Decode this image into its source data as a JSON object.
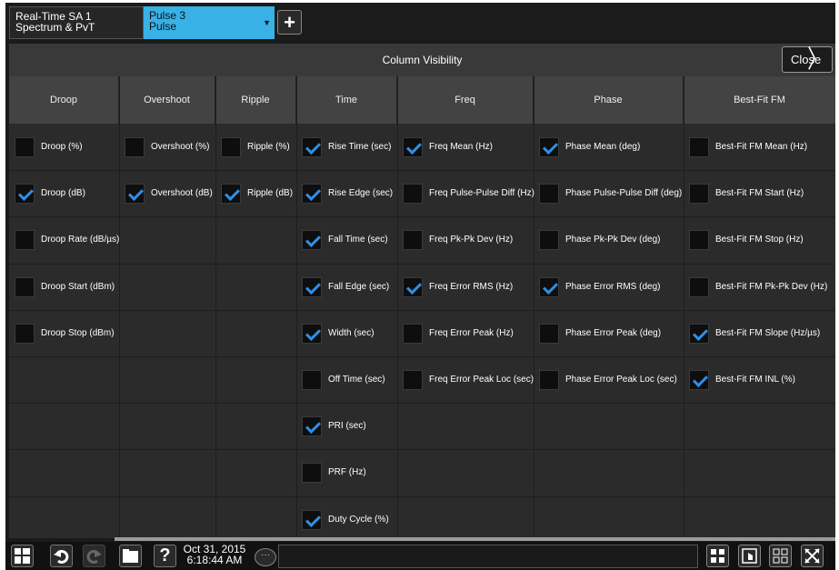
{
  "tabs": {
    "screen_tab": {
      "line1": "Real-Time SA 1",
      "line2": "Spectrum & PvT"
    },
    "measure_tab": {
      "line1": "Pulse 3",
      "line2": "Pulse",
      "arrow": "▼"
    },
    "add_label": "+"
  },
  "dialog": {
    "title": "Column Visibility",
    "close_label": "Close",
    "close_chevron": "〉"
  },
  "columns": [
    "Droop",
    "Overshoot",
    "Ripple",
    "Time",
    "Freq",
    "Phase",
    "Best-Fit FM"
  ],
  "cells": {
    "droop": [
      {
        "label": "Droop (%)",
        "checked": false
      },
      {
        "label": "Droop (dB)",
        "checked": true
      },
      {
        "label": "Droop Rate (dB/µs)",
        "checked": false
      },
      {
        "label": "Droop Start (dBm)",
        "checked": false
      },
      {
        "label": "Droop Stop (dBm)",
        "checked": false
      }
    ],
    "overshoot": [
      {
        "label": "Overshoot (%)",
        "checked": false
      },
      {
        "label": "Overshoot (dB)",
        "checked": true
      }
    ],
    "ripple": [
      {
        "label": "Ripple (%)",
        "checked": false
      },
      {
        "label": "Ripple (dB)",
        "checked": true
      }
    ],
    "time": [
      {
        "label": "Rise Time (sec)",
        "checked": true
      },
      {
        "label": "Rise Edge (sec)",
        "checked": true
      },
      {
        "label": "Fall Time (sec)",
        "checked": true
      },
      {
        "label": "Fall Edge (sec)",
        "checked": true
      },
      {
        "label": "Width (sec)",
        "checked": true
      },
      {
        "label": "Off Time (sec)",
        "checked": false
      },
      {
        "label": "PRI (sec)",
        "checked": true
      },
      {
        "label": "PRF (Hz)",
        "checked": false
      },
      {
        "label": "Duty Cycle (%)",
        "checked": true
      }
    ],
    "freq": [
      {
        "label": "Freq Mean (Hz)",
        "checked": true
      },
      {
        "label": "Freq Pulse-Pulse Diff (Hz)",
        "checked": false
      },
      {
        "label": "Freq Pk-Pk Dev (Hz)",
        "checked": false
      },
      {
        "label": "Freq Error RMS (Hz)",
        "checked": true
      },
      {
        "label": "Freq Error Peak (Hz)",
        "checked": false
      },
      {
        "label": "Freq Error Peak Loc (sec)",
        "checked": false
      }
    ],
    "phase": [
      {
        "label": "Phase Mean (deg)",
        "checked": true
      },
      {
        "label": "Phase Pulse-Pulse Diff (deg)",
        "checked": false
      },
      {
        "label": "Phase Pk-Pk Dev (deg)",
        "checked": false
      },
      {
        "label": "Phase Error RMS (deg)",
        "checked": true
      },
      {
        "label": "Phase Error Peak (deg)",
        "checked": false
      },
      {
        "label": "Phase Error Peak Loc (sec)",
        "checked": false
      }
    ],
    "bestfit": [
      {
        "label": "Best-Fit FM Mean (Hz)",
        "checked": false
      },
      {
        "label": "Best-Fit FM Start (Hz)",
        "checked": false
      },
      {
        "label": "Best-Fit FM Stop (Hz)",
        "checked": false
      },
      {
        "label": "Best-Fit FM Pk-Pk Dev (Hz)",
        "checked": false
      },
      {
        "label": "Best-Fit FM Slope (Hz/µs)",
        "checked": true
      },
      {
        "label": "Best-Fit FM INL (%)",
        "checked": true
      }
    ]
  },
  "taskbar": {
    "date": "Oct 31, 2015",
    "time": "6:18:44 AM",
    "icons": [
      "windows-icon",
      "undo-icon",
      "redo-icon",
      "folder-icon",
      "help-icon",
      "chat-icon",
      "layout-grid-icon",
      "touch-icon",
      "multi-window-icon",
      "fullscreen-icon"
    ]
  },
  "colors": {
    "accent": "#38b1e6",
    "check": "#2f8fe6",
    "header_bg": "#434343",
    "grid_bg": "#2b2b2b"
  }
}
